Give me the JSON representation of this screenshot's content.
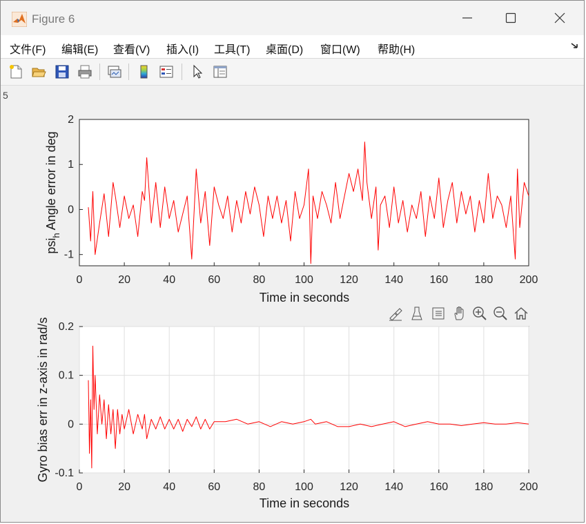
{
  "window": {
    "title": "Figure 6",
    "app_icon": "matlab-icon",
    "controls": [
      "minimize-icon",
      "maximize-icon",
      "close-icon"
    ]
  },
  "menubar": {
    "items": [
      {
        "label": "文件(F)"
      },
      {
        "label": "编辑(E)"
      },
      {
        "label": "查看(V)"
      },
      {
        "label": "插入(I)"
      },
      {
        "label": "工具(T)"
      },
      {
        "label": "桌面(D)"
      },
      {
        "label": "窗口(W)"
      },
      {
        "label": "帮助(H)"
      }
    ],
    "dock_icon": "dock-arrow-icon"
  },
  "toolbar": {
    "buttons": [
      "new-figure-icon",
      "open-file-icon",
      "save-icon",
      "print-icon",
      "link-plot-icon",
      "colorbar-icon",
      "legend-icon",
      "pointer-icon",
      "property-inspector-icon"
    ]
  },
  "axes_toolbar": {
    "buttons": [
      "brush-icon",
      "data-tips-icon",
      "restore-view-icon",
      "pan-icon",
      "zoom-in-icon",
      "zoom-out-icon",
      "home-icon"
    ]
  },
  "figure": {
    "left_stub_text": "5"
  },
  "colors": {
    "line": "#ff0000",
    "axes_bg": "#ffffff",
    "figure_bg": "#f0f0f0",
    "grid": "#dfdfdf"
  },
  "chart_data": [
    {
      "type": "line",
      "title": "",
      "xlabel": "Time in seconds",
      "ylabel_main": "psi",
      "ylabel_sub": "h",
      "ylabel_rest": " Angle error in deg",
      "xlim": [
        0,
        200
      ],
      "ylim": [
        -1.25,
        2
      ],
      "xticks": [
        "0",
        "20",
        "40",
        "60",
        "80",
        "100",
        "120",
        "140",
        "160",
        "180",
        "200"
      ],
      "yticks": [
        "-1",
        "0",
        "1",
        "2"
      ],
      "grid": false,
      "series": [
        {
          "color": "#ff0000",
          "x": [
            4,
            5,
            6,
            7,
            9,
            11,
            13,
            15,
            16,
            18,
            20,
            22,
            24,
            26,
            28,
            29,
            30,
            32,
            34,
            36,
            38,
            40,
            42,
            44,
            46,
            48,
            50,
            52,
            54,
            56,
            58,
            60,
            62,
            64,
            66,
            68,
            70,
            72,
            74,
            76,
            78,
            80,
            82,
            84,
            86,
            88,
            90,
            92,
            94,
            96,
            98,
            100,
            102,
            103,
            104,
            106,
            108,
            110,
            112,
            114,
            116,
            118,
            120,
            122,
            124,
            126,
            127,
            128,
            130,
            132,
            133,
            134,
            136,
            138,
            140,
            142,
            144,
            146,
            148,
            150,
            152,
            154,
            156,
            158,
            160,
            162,
            164,
            166,
            168,
            170,
            172,
            174,
            176,
            178,
            180,
            182,
            184,
            186,
            188,
            190,
            192,
            194,
            195,
            196,
            198,
            200
          ],
          "y": [
            0.05,
            -0.7,
            0.4,
            -1.0,
            -0.3,
            0.35,
            -0.6,
            0.6,
            0.3,
            -0.4,
            0.3,
            -0.2,
            0.1,
            -0.6,
            0.4,
            0.2,
            1.15,
            -0.3,
            0.6,
            -0.4,
            0.5,
            -0.2,
            0.2,
            -0.5,
            -0.1,
            0.3,
            -1.1,
            0.9,
            -0.3,
            0.4,
            -0.8,
            0.5,
            0.1,
            -0.2,
            0.3,
            -0.5,
            0.2,
            -0.3,
            0.4,
            -0.1,
            0.5,
            0.1,
            -0.6,
            0.3,
            -0.2,
            0.3,
            -0.3,
            0.2,
            -0.7,
            0.4,
            -0.2,
            0.1,
            0.9,
            -1.2,
            0.3,
            -0.2,
            0.4,
            0.1,
            -0.3,
            0.6,
            -0.2,
            0.3,
            0.8,
            0.4,
            0.9,
            0.2,
            1.5,
            0.6,
            -0.2,
            0.5,
            -0.9,
            0.1,
            0.3,
            -0.4,
            0.5,
            -0.3,
            0.2,
            -0.5,
            0.1,
            -0.2,
            0.4,
            -0.6,
            0.3,
            -0.2,
            0.7,
            -0.4,
            0.2,
            0.6,
            -0.3,
            0.4,
            -0.1,
            0.3,
            -0.5,
            0.2,
            -0.3,
            0.8,
            -0.2,
            0.3,
            0.1,
            -0.4,
            0.3,
            -1.1,
            0.9,
            -0.4,
            0.6,
            0.3
          ]
        }
      ]
    },
    {
      "type": "line",
      "title": "",
      "xlabel": "Time in seconds",
      "ylabel": "Gyro bias err in z-axis in rad/s",
      "xlim": [
        0,
        200
      ],
      "ylim": [
        -0.1,
        0.2
      ],
      "xticks": [
        "0",
        "20",
        "40",
        "60",
        "80",
        "100",
        "120",
        "140",
        "160",
        "180",
        "200"
      ],
      "yticks": [
        "-0.1",
        "0",
        "0.1",
        "0.2"
      ],
      "grid": true,
      "series": [
        {
          "color": "#ff0000",
          "x": [
            4,
            4.5,
            5,
            5.5,
            6,
            6.5,
            7,
            8,
            9,
            10,
            11,
            12,
            13,
            14,
            15,
            16,
            17,
            18,
            19,
            20,
            22,
            24,
            26,
            28,
            29,
            30,
            32,
            34,
            36,
            38,
            40,
            42,
            44,
            46,
            48,
            50,
            52,
            54,
            56,
            58,
            60,
            65,
            70,
            75,
            80,
            85,
            90,
            95,
            100,
            103,
            105,
            110,
            115,
            120,
            125,
            130,
            135,
            140,
            145,
            150,
            155,
            160,
            165,
            170,
            175,
            180,
            185,
            190,
            195,
            200
          ],
          "y": [
            0.09,
            -0.06,
            0.05,
            -0.09,
            0.16,
            0.03,
            0.1,
            -0.02,
            0.06,
            0.0,
            0.05,
            -0.03,
            0.04,
            -0.02,
            0.03,
            -0.05,
            0.03,
            -0.02,
            0.02,
            -0.01,
            0.03,
            -0.02,
            0.02,
            -0.01,
            0.02,
            -0.03,
            0.01,
            -0.01,
            0.015,
            -0.01,
            0.01,
            -0.01,
            0.01,
            -0.015,
            0.01,
            -0.005,
            0.015,
            -0.01,
            0.01,
            -0.01,
            0.005,
            0.005,
            0.01,
            0.0,
            0.005,
            -0.005,
            0.005,
            0.0,
            0.005,
            0.01,
            0.0,
            0.005,
            -0.005,
            -0.005,
            0.0,
            -0.005,
            0.0,
            0.005,
            -0.005,
            0.0,
            0.005,
            0.0,
            0.0,
            -0.003,
            0.0,
            0.003,
            0.0,
            0.0,
            0.003,
            0.0
          ]
        }
      ]
    }
  ]
}
